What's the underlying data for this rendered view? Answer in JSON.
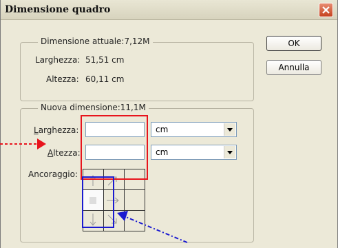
{
  "window": {
    "title": "Dimensione quadro"
  },
  "current": {
    "legend": "Dimensione attuale:7,12M",
    "width_label": "Larghezza:",
    "width_value": "51,51 cm",
    "height_label": "Altezza:",
    "height_value": "60,11 cm"
  },
  "new": {
    "legend": "Nuova dimensione:11,1M",
    "width_label_accel": "L",
    "width_label_rest": "arghezza:",
    "width_value": "",
    "width_unit": "cm",
    "height_label_accel": "A",
    "height_label_rest": "ltezza:",
    "height_value": "",
    "height_unit": "cm",
    "anchor_label": "Ancoraggio:"
  },
  "buttons": {
    "ok": "OK",
    "cancel": "Annulla"
  },
  "colors": {
    "annotation_red": "#e8141c",
    "annotation_blue": "#1a1ad0"
  }
}
